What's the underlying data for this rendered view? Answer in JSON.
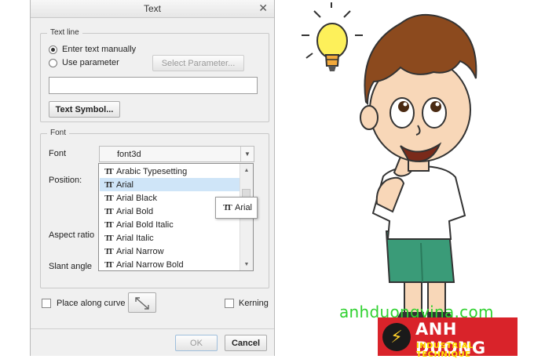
{
  "dialog": {
    "title": "Text",
    "text_line": {
      "legend": "Text line",
      "option_manual": "Enter text manually",
      "option_parameter": "Use parameter",
      "select_parameter_button": "Select Parameter...",
      "text_value": "",
      "text_symbol_button": "Text Symbol..."
    },
    "font": {
      "legend": "Font",
      "font_label": "Font",
      "font_value": "font3d",
      "position_label": "Position:",
      "aspect_ratio_label": "Aspect ratio",
      "slant_angle_label": "Slant angle",
      "list_items": [
        "Arabic Typesetting",
        "Arial",
        "Arial Black",
        "Arial Bold",
        "Arial Bold Italic",
        "Arial Italic",
        "Arial Narrow",
        "Arial Narrow Bold"
      ],
      "selected_item": "Arial",
      "tooltip": "Arial"
    },
    "place_along_curve_label": "Place along curve",
    "kerning_label": "Kerning",
    "ok_button": "OK",
    "cancel_button": "Cancel"
  },
  "branding": {
    "url": "anhduongvina.com",
    "logo_name": "ANH DUONG",
    "logo_tagline": "INDUSTRIAL TECHNIQUE",
    "colors": {
      "logo_bg": "#d9232a",
      "url_text": "#2fd12f",
      "tagline": "#ffe100"
    }
  },
  "icons": [
    "close-icon",
    "tt-font-icon",
    "scroll-up-icon",
    "scroll-down-icon",
    "flip-direction-icon",
    "lightning-bolt-icon",
    "light-bulb-icon"
  ]
}
